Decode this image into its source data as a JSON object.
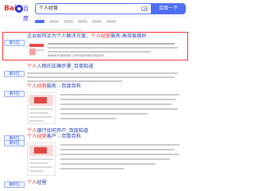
{
  "header": {
    "logo_main": "Bai",
    "logo_sub": "百度",
    "search_value": "个人经营",
    "search_button": "百度一下"
  },
  "results": [
    {
      "badge": "第1位",
      "title_prefix": "企业如何正为个人解决方案，",
      "title_highlight": "个人经营",
      "title_suffix": "服务-高效易做好",
      "url": "www.enbaike.com/products/pro..."
    },
    {
      "badge": "第2位",
      "title_prefix": "",
      "title_highlight": "个人",
      "title_suffix": "入网的正确步骤_百度知道"
    },
    {
      "badge": "第3位",
      "title_prefix": "",
      "title_highlight": "个人经营",
      "title_suffix": "服务 - 百度百科"
    },
    {
      "badge": "第4位",
      "title_prefix": "",
      "title_highlight": "个人",
      "title_suffix": "银行如何开户_百度知道"
    },
    {
      "badge": "第5位",
      "title_prefix": "",
      "title_highlight": "个人经营",
      "title_suffix": "客户 - 百度百科"
    },
    {
      "badge": "第6位",
      "title_prefix": "",
      "title_highlight": "个人",
      "title_suffix": "经营"
    }
  ]
}
